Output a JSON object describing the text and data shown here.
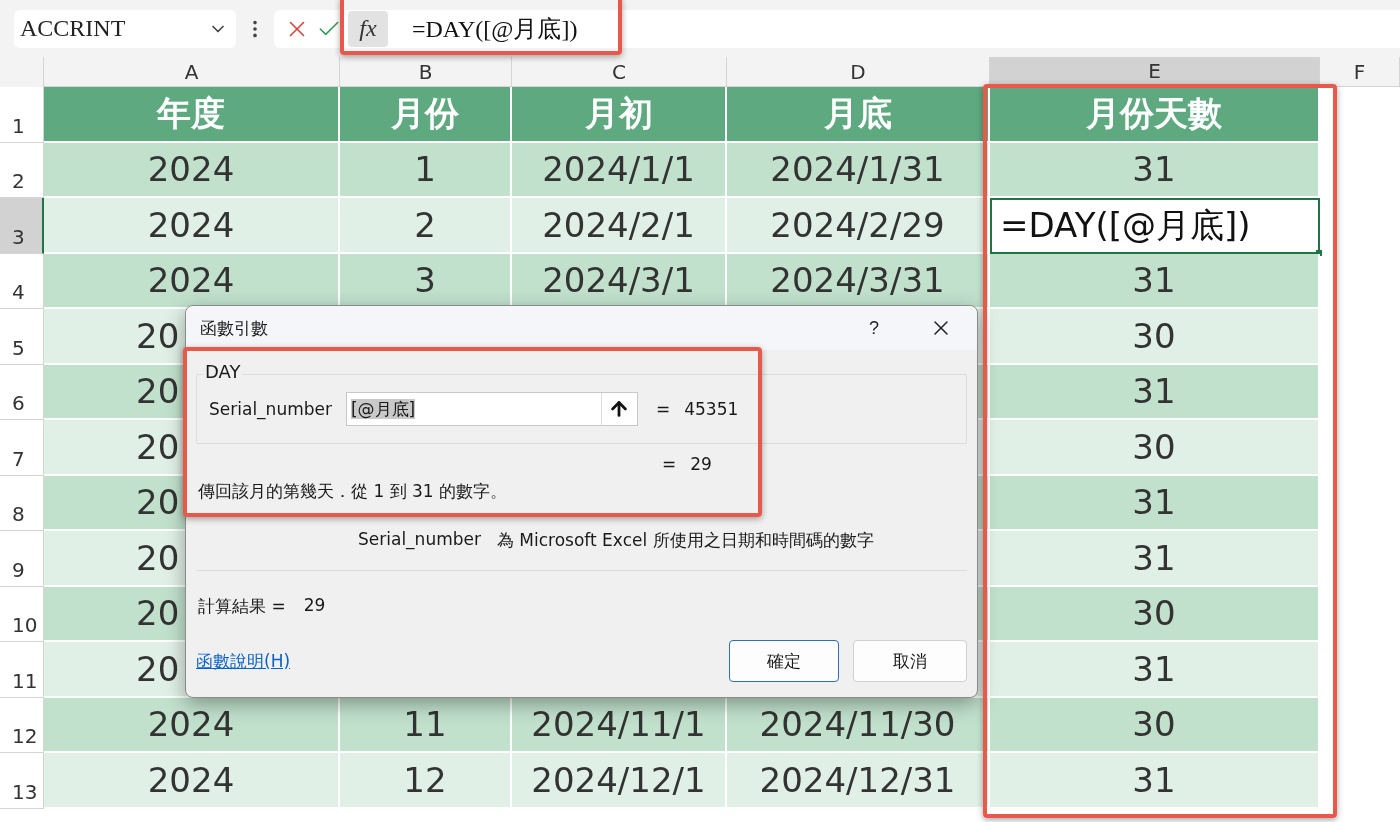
{
  "formula_bar": {
    "name_box": "ACCRINT",
    "fx": "fx",
    "formula": "=DAY([@月底])"
  },
  "column_headers": [
    {
      "label": "A",
      "selected": false
    },
    {
      "label": "B",
      "selected": false
    },
    {
      "label": "C",
      "selected": false
    },
    {
      "label": "D",
      "selected": false
    },
    {
      "label": "E",
      "selected": true
    },
    {
      "label": "F",
      "selected": false
    }
  ],
  "header_row": {
    "number": "1",
    "selected": false,
    "cells": [
      "年度",
      "月份",
      "月初",
      "月底",
      "月份天數"
    ]
  },
  "rows": [
    {
      "number": "2",
      "selected": false,
      "year": "2024",
      "month": "1",
      "start": "2024/1/1",
      "end": "2024/1/31",
      "days": "31"
    },
    {
      "number": "3",
      "selected": true,
      "year": "2024",
      "month": "2",
      "start": "2024/2/1",
      "end": "2024/2/29",
      "days": "=DAY([@月底])"
    },
    {
      "number": "4",
      "selected": false,
      "year": "2024",
      "month": "3",
      "start": "2024/3/1",
      "end": "2024/3/31",
      "days": "31"
    },
    {
      "number": "5",
      "selected": false,
      "year": "20",
      "days": "30"
    },
    {
      "number": "6",
      "selected": false,
      "year": "20",
      "days": "31"
    },
    {
      "number": "7",
      "selected": false,
      "year": "20",
      "days": "30"
    },
    {
      "number": "8",
      "selected": false,
      "year": "20",
      "days": "31"
    },
    {
      "number": "9",
      "selected": false,
      "year": "20",
      "days": "31"
    },
    {
      "number": "10",
      "selected": false,
      "year": "20",
      "days": "30"
    },
    {
      "number": "11",
      "selected": false,
      "year": "20",
      "days": "31"
    },
    {
      "number": "12",
      "selected": false,
      "year": "2024",
      "month": "11",
      "start": "2024/11/1",
      "end": "2024/11/30",
      "days": "30"
    },
    {
      "number": "13",
      "selected": false,
      "year": "2024",
      "month": "12",
      "start": "2024/12/1",
      "end": "2024/12/31",
      "days": "31"
    }
  ],
  "dialog": {
    "title": "函數引數",
    "help": "?",
    "function_name": "DAY",
    "argument": {
      "label": "Serial_number",
      "value": "[@月底]",
      "equals": "=",
      "result": "45351"
    },
    "formula_equals": "=",
    "formula_result": "29",
    "description": "傳回該月的第幾天．從 1 到 31 的數字。",
    "argument_help_label": "Serial_number",
    "argument_help": "為 Microsoft Excel 所使用之日期和時間碼的數字",
    "result_label": "計算結果 =",
    "result_value": "29",
    "help_link": "函數說明(H)",
    "buttons": [
      {
        "label": "確定",
        "default": true
      },
      {
        "label": "取消",
        "default": false
      }
    ]
  }
}
